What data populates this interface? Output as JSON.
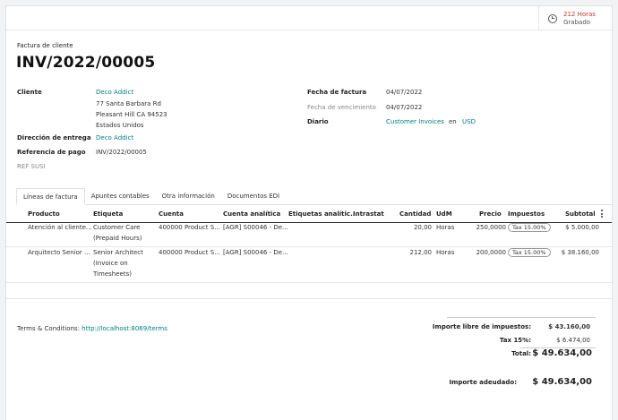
{
  "stat_button": {
    "value": "212 Horas",
    "label": "Grabado",
    "icon": "clock-icon"
  },
  "document": {
    "type": "Factura de cliente",
    "number": "INV/2022/00005"
  },
  "customer": {
    "label": "Cliente",
    "name": "Deco Addict",
    "address": [
      "77 Santa Barbara Rd",
      "Pleasant Hill CA 94523",
      "Estados Unidos"
    ]
  },
  "delivery": {
    "label": "Dirección de entrega",
    "value": "Deco Addict"
  },
  "payment_ref": {
    "label": "Referencia de pago",
    "value": "INV/2022/00005"
  },
  "ref_note": "REF SUSI",
  "invoice_date": {
    "label": "Fecha de factura",
    "value": "04/07/2022"
  },
  "due_date": {
    "label": "Fecha de vencimiento",
    "value": "04/07/2022"
  },
  "journal": {
    "label": "Diario",
    "value": "Customer Invoices",
    "connector": "en",
    "currency": "USD"
  },
  "tabs": [
    {
      "label": "Líneas de factura",
      "active": true
    },
    {
      "label": "Apuntes contables",
      "active": false
    },
    {
      "label": "Otra información",
      "active": false
    },
    {
      "label": "Documentos EDI",
      "active": false
    }
  ],
  "table": {
    "columns": [
      "Producto",
      "Etiqueta",
      "Cuenta",
      "Cuenta analítica",
      "Etiquetas analític...",
      "Intrastat",
      "Cantidad",
      "UdM",
      "Precio",
      "Impuestos",
      "Subtotal"
    ],
    "rows": [
      {
        "product": "Atención al cliente...",
        "label": [
          "Customer Care",
          "(Prepaid Hours)"
        ],
        "account": "400000 Product S...",
        "analytic": "[AGR] S00046 - De...",
        "qty": "20,00",
        "uom": "Horas",
        "price": "250,0000",
        "tax": "Tax 15.00%",
        "subtotal": "$ 5.000,00"
      },
      {
        "product": "Arquitecto Senior ...",
        "label": [
          "Senior Architect",
          "(Invoice on",
          "Timesheets)"
        ],
        "account": "400000 Product S...",
        "analytic": "[AGR] S00046 - De...",
        "qty": "212,00",
        "uom": "Horas",
        "price": "200,0000",
        "tax": "Tax 15.00%",
        "subtotal": "$ 38.160,00"
      }
    ]
  },
  "terms": {
    "label": "Terms & Conditions:",
    "url": "http://localhost:8069/terms"
  },
  "totals": {
    "untaxed_label": "Importe libre de impuestos:",
    "untaxed_value": "$ 43.160,00",
    "tax_label": "Tax 15%:",
    "tax_value": "$ 6.474,00",
    "total_label": "Total:",
    "total_value": "$ 49.634,00",
    "due_label": "Importe adeudado:",
    "due_value": "$ 49.634,00"
  }
}
